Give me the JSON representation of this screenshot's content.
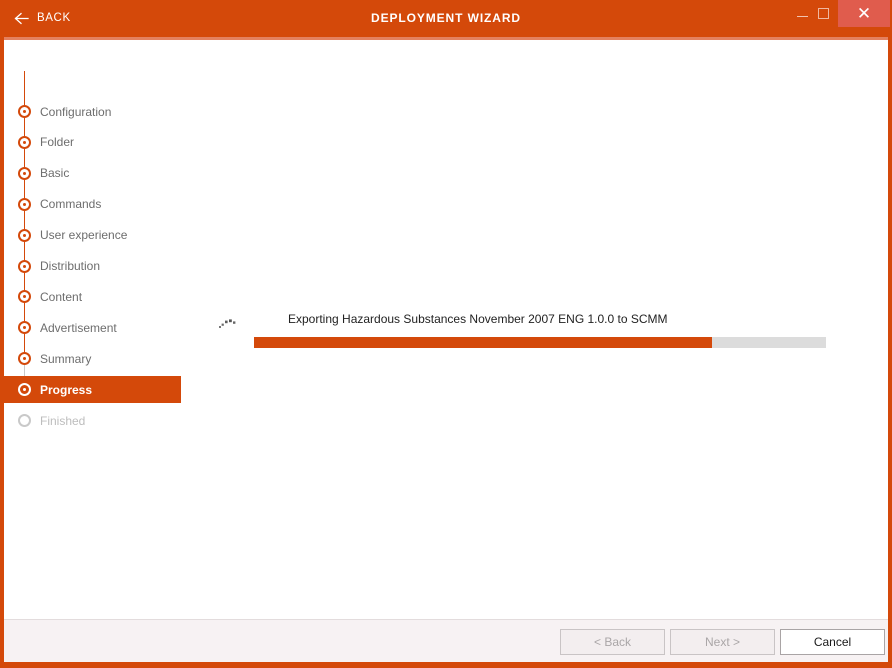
{
  "window": {
    "title": "DEPLOYMENT WIZARD",
    "back_label": "BACK",
    "back_icon": "arrow-left-icon",
    "minimize_icon": "minimize-icon",
    "maximize_icon": "maximize-icon",
    "close_icon": "close-icon",
    "accent_color": "#d4490a",
    "close_button_color": "#e05c4d"
  },
  "steps": [
    {
      "label": "Configuration",
      "state": "complete"
    },
    {
      "label": "Folder",
      "state": "complete"
    },
    {
      "label": "Basic",
      "state": "complete"
    },
    {
      "label": "Commands",
      "state": "complete"
    },
    {
      "label": "User experience",
      "state": "complete"
    },
    {
      "label": "Distribution",
      "state": "complete"
    },
    {
      "label": "Content",
      "state": "complete"
    },
    {
      "label": "Advertisement",
      "state": "complete"
    },
    {
      "label": "Summary",
      "state": "complete"
    },
    {
      "label": "Progress",
      "state": "active"
    },
    {
      "label": "Finished",
      "state": "pending"
    }
  ],
  "main": {
    "task_text": "Exporting Hazardous Substances November 2007 ENG 1.0.0 to SCMM",
    "spinner_icon": "loading-spinner-icon",
    "progress": {
      "percent": 80,
      "fill_color": "#d4490a",
      "track_color": "#dcdcdc"
    }
  },
  "footer": {
    "back_label": "< Back",
    "next_label": "Next >",
    "cancel_label": "Cancel"
  }
}
